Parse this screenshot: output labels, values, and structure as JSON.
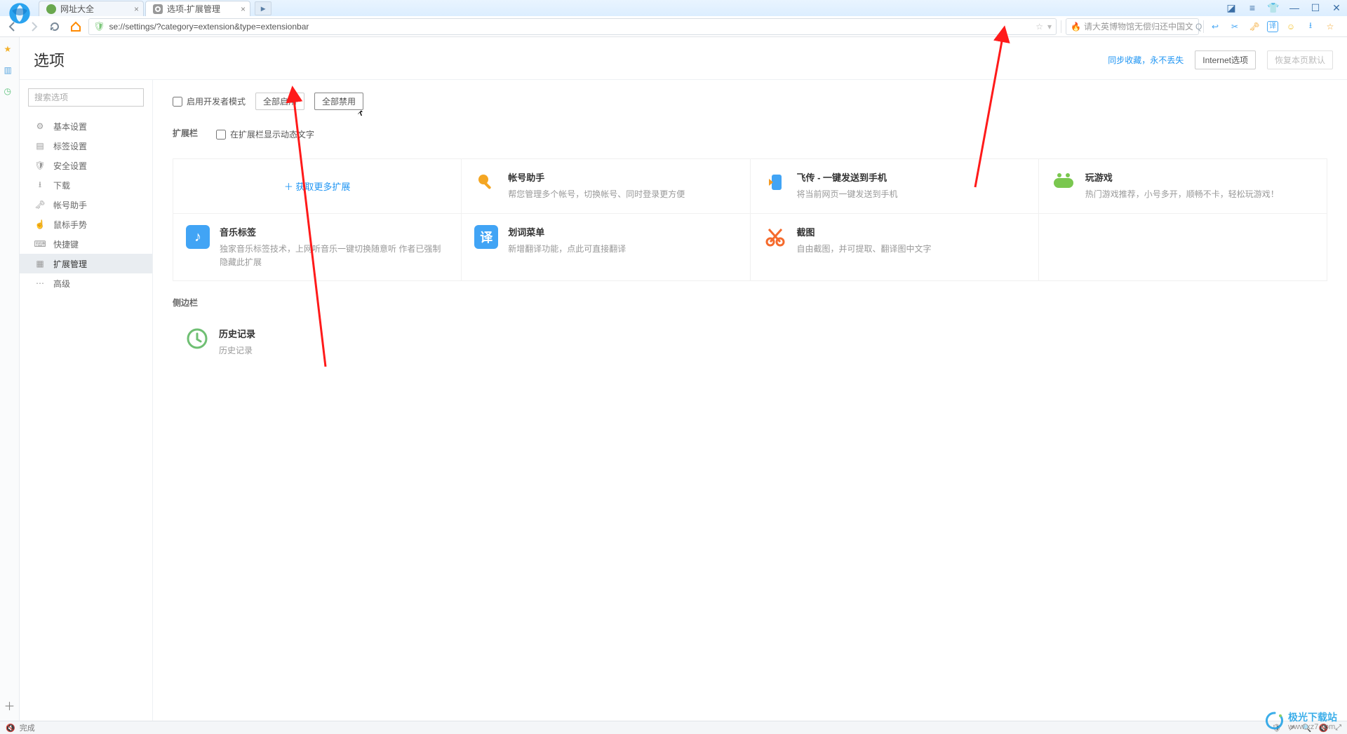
{
  "titlebar": {
    "tabs": [
      {
        "label": "网址大全",
        "active": false
      },
      {
        "label": "选项-扩展管理",
        "active": true
      }
    ]
  },
  "toolbar": {
    "address": "se://settings/?category=extension&type=extensionbar",
    "search_placeholder": "请大英博物馆无偿归还中国文"
  },
  "page": {
    "title": "选项",
    "sync_link": "同步收藏，永不丢失",
    "internet_btn": "Internet选项",
    "restore_btn": "恢复本页默认"
  },
  "nav": {
    "search_placeholder": "搜索选项",
    "items": [
      {
        "label": "基本设置"
      },
      {
        "label": "标签设置"
      },
      {
        "label": "安全设置"
      },
      {
        "label": "下载"
      },
      {
        "label": "帐号助手"
      },
      {
        "label": "鼠标手势"
      },
      {
        "label": "快捷键"
      },
      {
        "label": "扩展管理"
      },
      {
        "label": "高级"
      }
    ],
    "active_index": 7
  },
  "content": {
    "dev_mode_label": "启用开发者模式",
    "enable_all": "全部启用",
    "disable_all": "全部禁用",
    "section_bar": "扩展栏",
    "show_text_label": "在扩展栏显示动态文字",
    "get_more": "＋ 获取更多扩展",
    "section_sidebar": "侧边栏",
    "ext_bar": [
      {
        "title": "帐号助手",
        "desc": "帮您管理多个帐号，切换帐号、同时登录更方便"
      },
      {
        "title": "飞传 - 一键发送到手机",
        "desc": "将当前网页一键发送到手机"
      },
      {
        "title": "玩游戏",
        "desc": "热门游戏推荐，小号多开，顺畅不卡，轻松玩游戏！"
      },
      {
        "title": "音乐标签",
        "desc": "独家音乐标签技术，上网听音乐一键切换随意听  作者已强制隐藏此扩展"
      },
      {
        "title": "划词菜单",
        "desc": "新增翻译功能，点此可直接翻译"
      },
      {
        "title": "截图",
        "desc": "自由截图，并可提取、翻译图中文字"
      }
    ],
    "ext_sidebar": [
      {
        "title": "历史记录",
        "desc": "历史记录"
      }
    ]
  },
  "status": {
    "done": "完成"
  },
  "watermark": {
    "brand": "极光下载站",
    "url": "www.xz7.com"
  }
}
